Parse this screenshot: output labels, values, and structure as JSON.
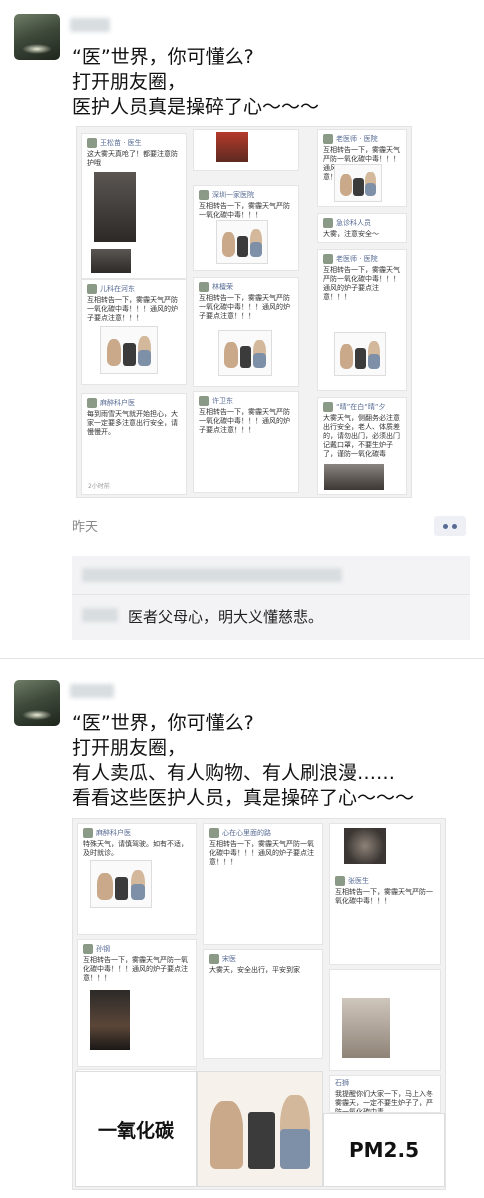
{
  "posts": [
    {
      "text_lines": [
        "“医”世界，你可懂么?",
        "打开朋友圈，",
        "医护人员真是操碎了心～～～"
      ],
      "time": "昨天",
      "comment": "医者父母心，明大义懂慈悲。",
      "cards": [
        {
          "name": "王松苗 · 医生",
          "text": "这大雾天真呛了！都要注意防护哦"
        },
        {
          "name": "深圳一家医院",
          "text": "互相转告一下，雾霾天气严防一氧化碳中毒！！！"
        },
        {
          "name": "老医师 · 医院",
          "text": "互相转告一下，雾霾天气严防一氧化碳中毒！！！通风的炉子要点注意！！！"
        },
        {
          "name": "儿科在河东",
          "text": "互相转告一下，雾霾天气严防一氧化碳中毒！！！通风的炉子要点注意！！！"
        },
        {
          "name": "林檀荣",
          "text": "互相转告一下，雾霾天气严防一氧化碳中毒！！！通风的炉子要点注意！！！"
        },
        {
          "name": "急诊科人员",
          "text": "大雾，注意安全～"
        },
        {
          "name": "麻醉科户医",
          "text": "每到雨雪天气就开始担心，大家一定要多注意出行安全，请慢慢开。"
        },
        {
          "name": "许卫东",
          "text": "互相转告一下，雾霾天气严防一氧化碳中毒！！！通风的炉子要点注意！！！"
        },
        {
          "name": "“晴”在白“晴”夕",
          "text": "大雾天气，侧翻务必注意出行安全，老人、体质差的，请勿出门，必须出门记戴口罩，不要生炉子了，谨防一氧化碳毒"
        }
      ]
    },
    {
      "text_lines": [
        "“医”世界，你可懂么?",
        "打开朋友圈，",
        "有人卖瓜、有人购物、有人刷浪漫……",
        "看看这些医护人员，真是操碎了心～～～"
      ],
      "cards": [
        {
          "name": "麻醉科户医",
          "text": "特殊天气，请慎驾驶。如有不适，及时就诊。"
        },
        {
          "name": "心在心里面的路",
          "text": "互相转告一下，雾霾天气严防一氧化碳中毒！！！通风的炉子要点注意！！！"
        },
        {
          "name": "张医生",
          "text": "互相转告一下，雾霾天气严防一氧化碳中毒！！！"
        },
        {
          "name": "孙钢",
          "text": "互相转告一下，雾霾天气严防一氧化碳中毒！！！通风的炉子要点注意！！！"
        },
        {
          "name": "宋医",
          "text": "大雾天，安全出行，平安到家"
        },
        {
          "name": "石狮",
          "text": "我提醒你们大家一下，马上入冬雾霾天，一定不要生炉子了，严防一氧化碳中毒"
        }
      ],
      "banner_left": "一氧化碳",
      "banner_right": "PM2.5"
    }
  ],
  "icons": {
    "avatar": "avatar-image",
    "more": "more-dots-icon"
  },
  "colors": {
    "link": "#576b95",
    "time": "#8a8a8a",
    "comment_bg": "#f3f3f5"
  }
}
